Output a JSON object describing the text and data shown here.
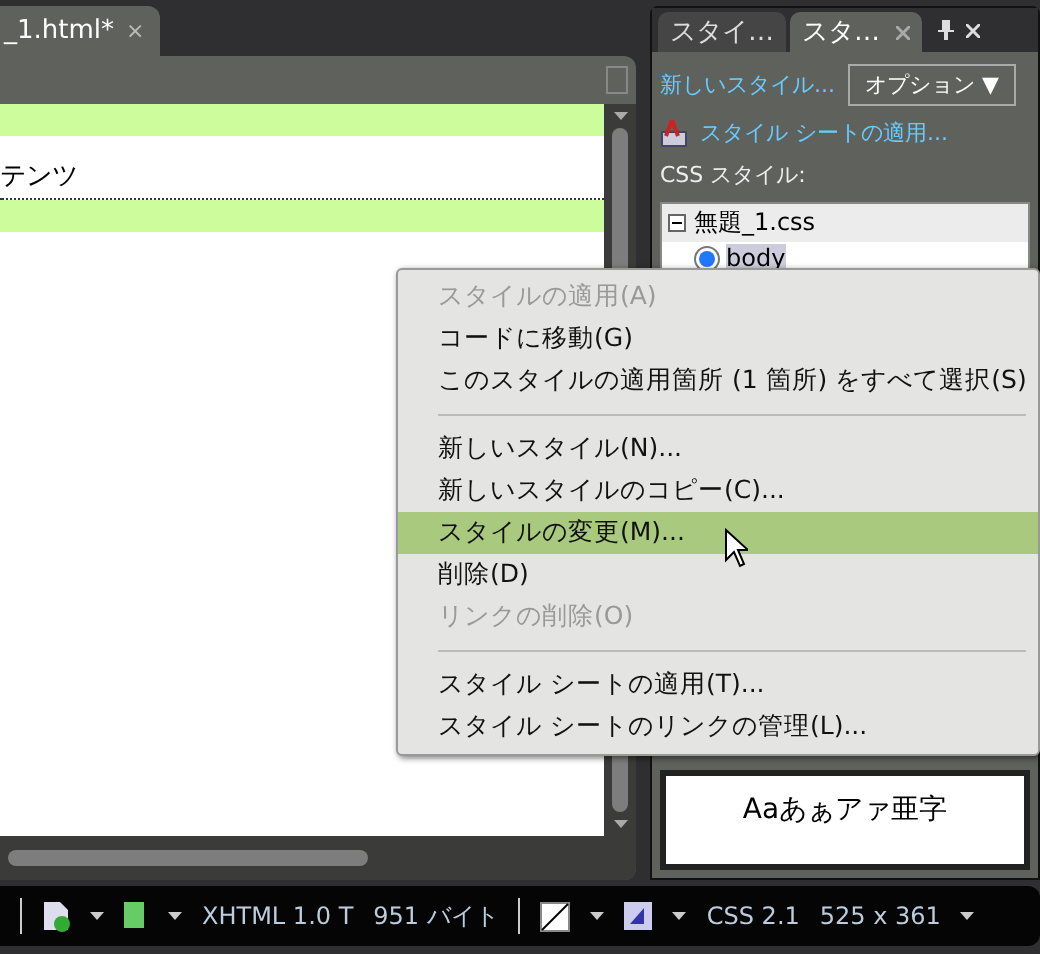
{
  "document_tab": {
    "title": "_1.html*",
    "close": "×"
  },
  "editor": {
    "lines": [
      {
        "kind": "band"
      },
      {
        "kind": "text",
        "text": "テンツ"
      },
      {
        "kind": "band"
      }
    ]
  },
  "panel": {
    "tabs": [
      {
        "label": "スタイ…",
        "selected": false
      },
      {
        "label": "スタ…",
        "selected": true
      }
    ],
    "new_style_link": "新しいスタイル...",
    "options_button": "オプション ▼",
    "attach_link": "スタイル シートの適用...",
    "css_label": "CSS スタイル:",
    "tree": [
      {
        "label": "無題_1.css",
        "expanded": true,
        "children": [
          {
            "label": "body",
            "selected": true
          }
        ]
      }
    ],
    "preview": "Aaあぁアァ亜字"
  },
  "context_menu": [
    {
      "kind": "item",
      "label": "スタイルの適用(A)",
      "disabled": true,
      "selected": false
    },
    {
      "kind": "item",
      "label": "コードに移動(G)",
      "disabled": false,
      "selected": false
    },
    {
      "kind": "item",
      "label": "このスタイルの適用箇所 (1 箇所) をすべて選択(S)",
      "disabled": false,
      "selected": false
    },
    {
      "kind": "separator"
    },
    {
      "kind": "item",
      "label": "新しいスタイル(N)...",
      "disabled": false,
      "selected": false
    },
    {
      "kind": "item",
      "label": "新しいスタイルのコピー(C)...",
      "disabled": false,
      "selected": false
    },
    {
      "kind": "item",
      "label": "スタイルの変更(M)...",
      "disabled": false,
      "selected": true
    },
    {
      "kind": "item",
      "label": "削除(D)",
      "disabled": false,
      "selected": false
    },
    {
      "kind": "item",
      "label": "リンクの削除(O)",
      "disabled": true,
      "selected": false
    },
    {
      "kind": "separator"
    },
    {
      "kind": "item",
      "label": "スタイル シートの適用(T)...",
      "disabled": false,
      "selected": false
    },
    {
      "kind": "item",
      "label": "スタイル シートのリンクの管理(L)...",
      "disabled": false,
      "selected": false
    }
  ],
  "status_bar": {
    "doc_type": "XHTML 1.0 T",
    "size": "951 バイト",
    "css_level": "CSS 2.1",
    "dimensions": "525 x 361"
  }
}
